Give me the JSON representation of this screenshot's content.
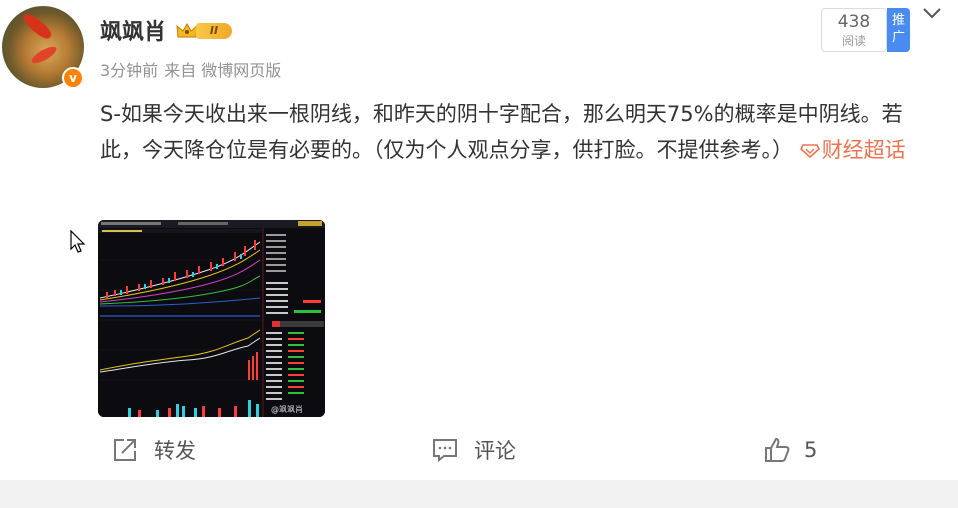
{
  "post": {
    "author": {
      "name": "飒飒肖",
      "vip_level": "II",
      "verified_badge": "v",
      "avatar_icon": "goldfish-avatar"
    },
    "meta": {
      "time": "3分钟前",
      "source": "来自 微博网页版"
    },
    "read": {
      "count": "438",
      "label": "阅读"
    },
    "promote_label": "推广",
    "content": {
      "text": "S-如果今天收出来一根阴线，和昨天的阴十字配合，那么明天75%的概率是中阴线。若此，今天降仓位是有必要的。（仅为个人观点分享，供打脸。不提供参考。）",
      "topic": "财经超话"
    },
    "image": {
      "watermark": "@飒飒肖",
      "description": "stock-chart-screenshot"
    },
    "actions": {
      "repost_label": "转发",
      "comment_label": "评论",
      "like_count": "5"
    }
  },
  "colors": {
    "accent": "#eb7350",
    "promo": "#4a8bf0",
    "vip_gold": "#f0a824",
    "verified": "#ff8200"
  },
  "icons": [
    "goldfish-avatar",
    "verified-icon",
    "vip-crown-icon",
    "chevron-down-icon",
    "topic-diamond-icon",
    "repost-icon",
    "comment-icon",
    "like-icon",
    "cursor-icon"
  ]
}
